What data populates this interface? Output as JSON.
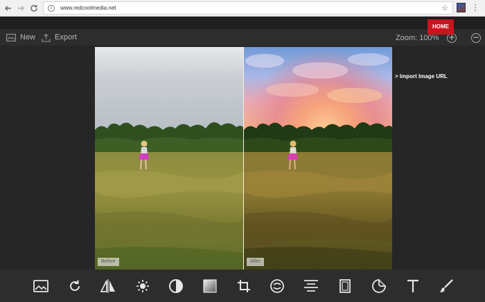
{
  "browser": {
    "url": "www.redcoolmedia.net",
    "back_icon": "back-arrow-icon",
    "forward_icon": "forward-arrow-icon",
    "reload_icon": "reload-icon"
  },
  "toolbar": {
    "new_label": "New",
    "export_label": "Export",
    "zoom_label": "Zoom: 100%",
    "home_label": "HOME"
  },
  "editor": {
    "before_label": "Before",
    "after_label": "After",
    "import_link": "> Import Image URL"
  },
  "bottom_tools": [
    {
      "icon": "image-icon"
    },
    {
      "icon": "rotate-icon"
    },
    {
      "icon": "flip-icon"
    },
    {
      "icon": "brightness-icon"
    },
    {
      "icon": "contrast-icon"
    },
    {
      "icon": "gradient-icon"
    },
    {
      "icon": "crop-icon"
    },
    {
      "icon": "distort-icon"
    },
    {
      "icon": "align-icon"
    },
    {
      "icon": "frame-icon"
    },
    {
      "icon": "sticker-icon"
    },
    {
      "icon": "text-icon"
    },
    {
      "icon": "brush-icon"
    }
  ],
  "colors": {
    "accent_home": "#c8141e",
    "toolbar_bg": "#2d2d2d",
    "icon_color": "#e6e6e6"
  }
}
